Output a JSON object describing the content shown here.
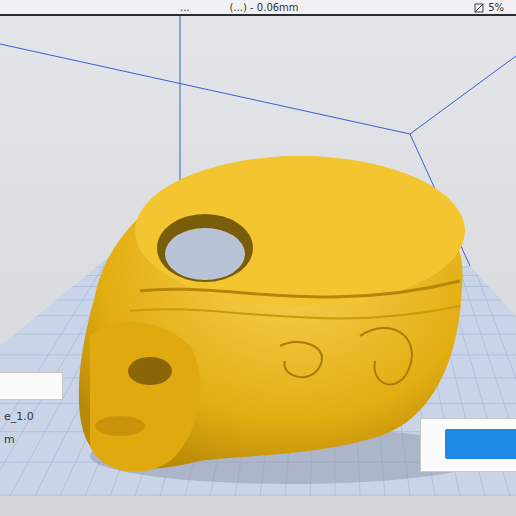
{
  "toolbar": {
    "items": [
      {
        "text": "..."
      },
      {
        "text": "(...) - 0.06mm"
      }
    ],
    "infill": "5%"
  },
  "object_panel": {
    "name": "e_1.0",
    "dimension": "m"
  }
}
